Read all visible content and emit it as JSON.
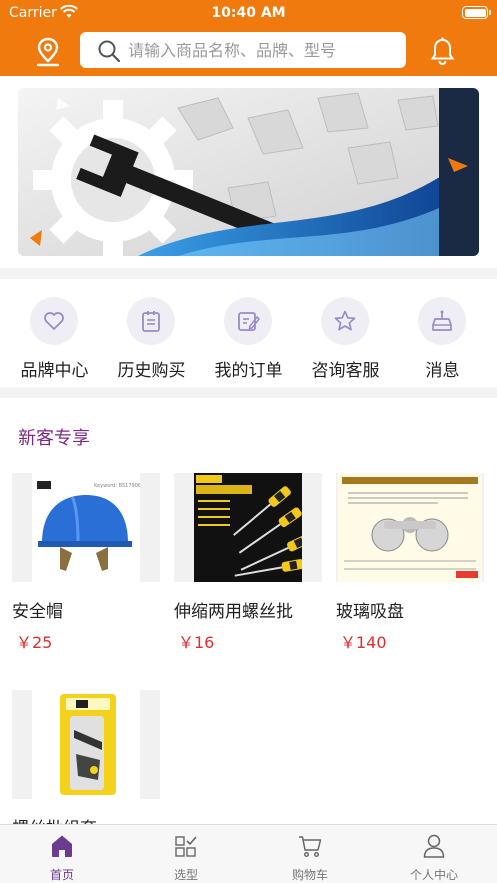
{
  "status_bar": {
    "carrier": "Carrier",
    "time": "10:40 AM"
  },
  "header": {
    "search_placeholder": "请输入商品名称、品牌、型号",
    "location_icon": "location-pin-icon",
    "search_icon": "magnifier-icon",
    "notification_icon": "bell-icon",
    "background_color": "#f07a0e"
  },
  "banner": {
    "image": "wrench-gear-banner"
  },
  "quick_menu": [
    {
      "label": "品牌中心",
      "icon": "heart-icon"
    },
    {
      "label": "历史购买",
      "icon": "clipboard-icon"
    },
    {
      "label": "我的订单",
      "icon": "order-edit-icon"
    },
    {
      "label": "咨询客服",
      "icon": "star-icon"
    },
    {
      "label": "消息",
      "icon": "message-tray-icon"
    }
  ],
  "new_customer": {
    "title": "新客专享",
    "products": [
      {
        "name": "安全帽",
        "price": "￥25",
        "image": "blue-safety-helmet"
      },
      {
        "name": "伸缩两用螺丝批",
        "price": "￥16",
        "image": "screwdriver-set"
      },
      {
        "name": "玻璃吸盘",
        "price": "￥140",
        "image": "suction-plate"
      },
      {
        "name": "螺丝批组套",
        "price": "",
        "image": "screwdriver-kit-pack"
      }
    ]
  },
  "tab_bar": [
    {
      "label": "首页",
      "icon": "home-icon",
      "active": true
    },
    {
      "label": "选型",
      "icon": "grid-select-icon",
      "active": false
    },
    {
      "label": "购物车",
      "icon": "cart-icon",
      "active": false
    },
    {
      "label": "个人中心",
      "icon": "person-icon",
      "active": false
    }
  ],
  "colors": {
    "accent": "#f07a0e",
    "brand_purple": "#7b2a83",
    "price_red": "#e02e2e",
    "tab_active": "#6a3b8f"
  }
}
